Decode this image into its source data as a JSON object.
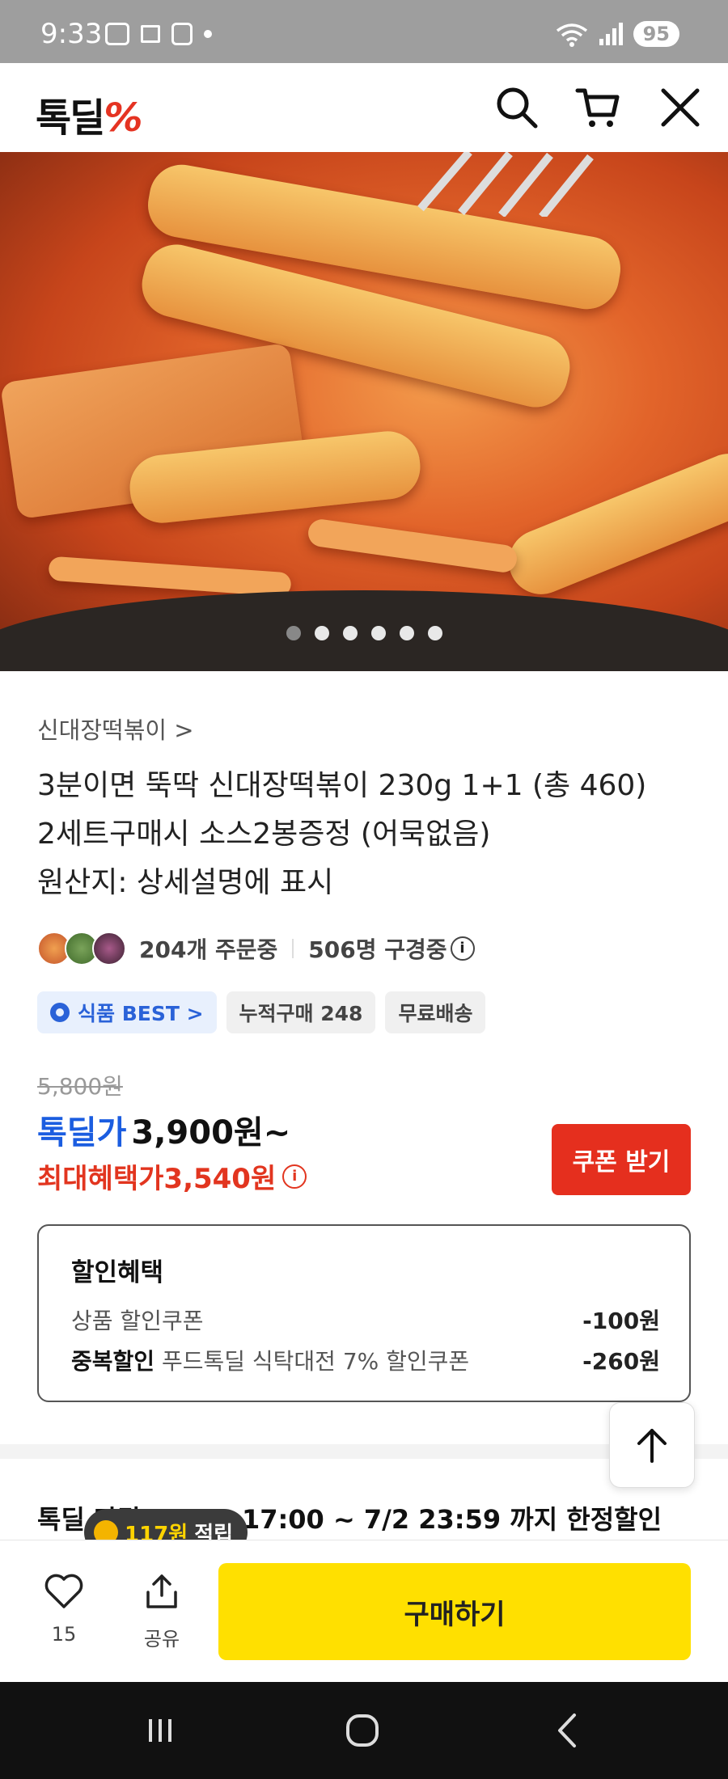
{
  "status_bar": {
    "time": "9:33",
    "battery": "95"
  },
  "header": {
    "logo_text": "톡딜",
    "logo_symbol": "%",
    "icons": [
      "search-icon",
      "cart-icon",
      "close-icon"
    ]
  },
  "hero": {
    "slide_count": 6,
    "active_slide": 1
  },
  "product": {
    "category": "신대장떡볶이 >",
    "title_lines": [
      "3분이면 뚝딱 신대장떡볶이 230g 1+1 (총 460)",
      "2세트구매시 소스2봉증정 (어묵없음)",
      "원산지: 상세설명에 표시"
    ],
    "orders": "204개 주문중",
    "viewers": "506명 구경중",
    "badges": {
      "best": "식품 BEST >",
      "cumulative": "누적구매 248",
      "shipping": "무료배송"
    },
    "original_price": "5,800원",
    "deal_label": "톡딜가",
    "deal_price": "3,900원~",
    "max_benefit_label": "최대혜택가",
    "max_benefit_price": "3,540원",
    "coupon_button": "쿠폰 받기"
  },
  "discount": {
    "title": "할인혜택",
    "row1_label": "상품 할인쿠폰",
    "row1_amount": "-100원",
    "row2_bold": "중복할인",
    "row2_label": " 푸드톡딜 식탁대전 7% 할인쿠폰",
    "row2_amount": "-260원"
  },
  "promo": {
    "text": "톡딜 마감 · 6/30 17:00 ~ 7/2 23:59 까지 한정할인"
  },
  "tooltip": {
    "points": "117원",
    "suffix": "적립"
  },
  "bottom_bar": {
    "like_count": "15",
    "share_label": "공유",
    "buy_label": "구매하기"
  },
  "colors": {
    "accent_red": "#e52f1e",
    "deal_blue": "#1b5de0",
    "buy_yellow": "#ffe000"
  }
}
